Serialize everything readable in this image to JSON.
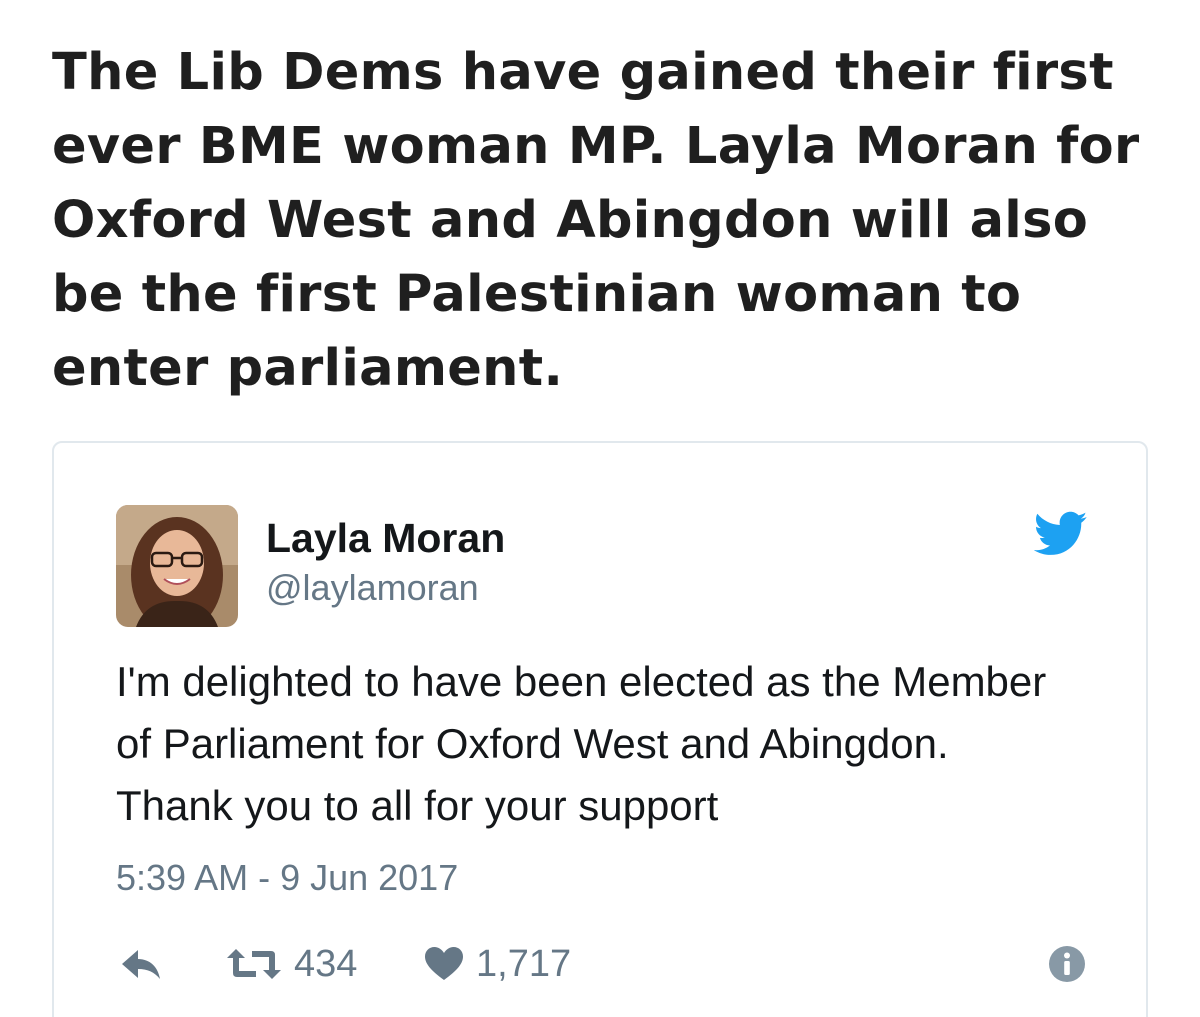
{
  "headline": "The Lib Dems have gained their first ever BME woman MP. Layla Moran for Oxford West and Abingdon will also be the first Palestinian woman to enter parliament.",
  "tweet": {
    "author_name": "Layla Moran",
    "author_handle": "@laylamoran",
    "text": "I'm delighted to have been elected as the Member of Parliament for Oxford West and Abingdon. Thank you to all for your support",
    "timestamp": "5:39 AM - 9 Jun 2017",
    "retweet_count": "434",
    "like_count": "1,717"
  },
  "icons": {
    "brand": "twitter-bird-icon",
    "reply": "reply-icon",
    "retweet": "retweet-icon",
    "like": "heart-icon",
    "info": "info-icon"
  },
  "colors": {
    "twitter_blue": "#1da1f2",
    "secondary_text": "#657786",
    "primary_text": "#14171a",
    "card_border": "#e1e8ed"
  }
}
